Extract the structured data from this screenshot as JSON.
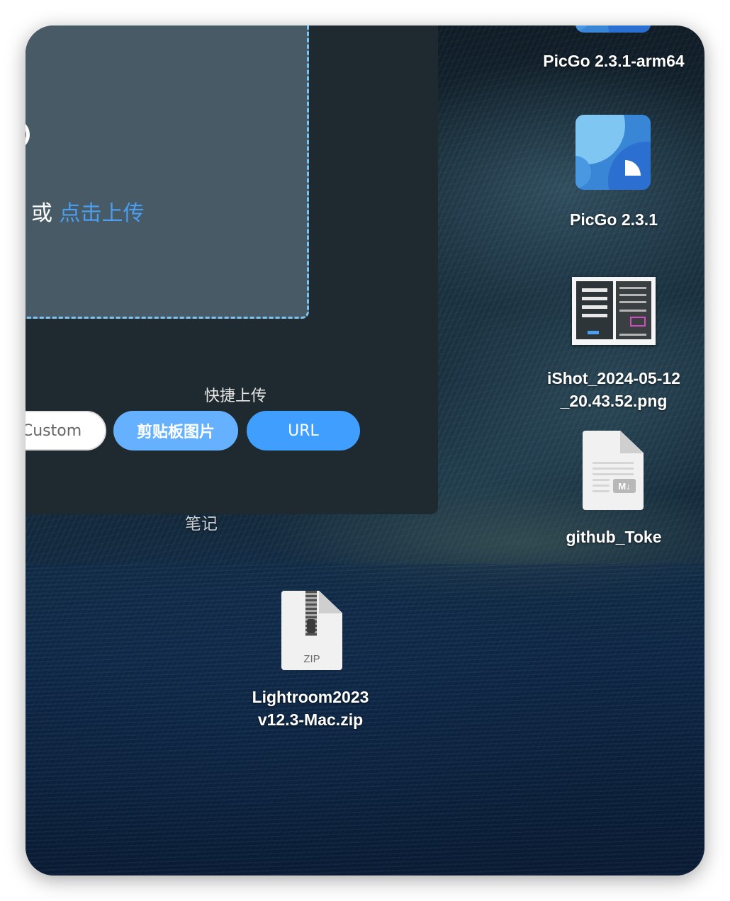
{
  "picgo_window": {
    "drop_prefix": "或",
    "drop_link": "点击上传",
    "quick_upload_title": "快捷上传",
    "buttons": {
      "custom": "Custom",
      "clipboard": "剪贴板图片",
      "url": "URL"
    }
  },
  "desktop": {
    "items": [
      {
        "label": "PicGo 2.3.1-arm64",
        "icon": "picgo-app-icon"
      },
      {
        "label": "PicGo 2.3.1",
        "icon": "picgo-app-icon"
      },
      {
        "label_lines": [
          "iShot_2024-05-12",
          "_20.43.52.png"
        ],
        "icon": "screenshot-thumbnail"
      },
      {
        "label": "github_Toke",
        "icon": "markdown-file-icon",
        "badge": "M↓"
      },
      {
        "label": "笔记",
        "icon": "folder"
      },
      {
        "label_lines": [
          "Lightroom2023",
          "v12.3-Mac.zip"
        ],
        "icon": "zip-file-icon",
        "badge": "ZIP"
      }
    ]
  },
  "colors": {
    "window_bg": "#1f2a30",
    "dropzone_bg": "#475a66",
    "dropzone_border": "#7fc3f0",
    "link": "#4a9ff0",
    "button_primary": "#409eff",
    "button_light": "#66b1ff"
  }
}
